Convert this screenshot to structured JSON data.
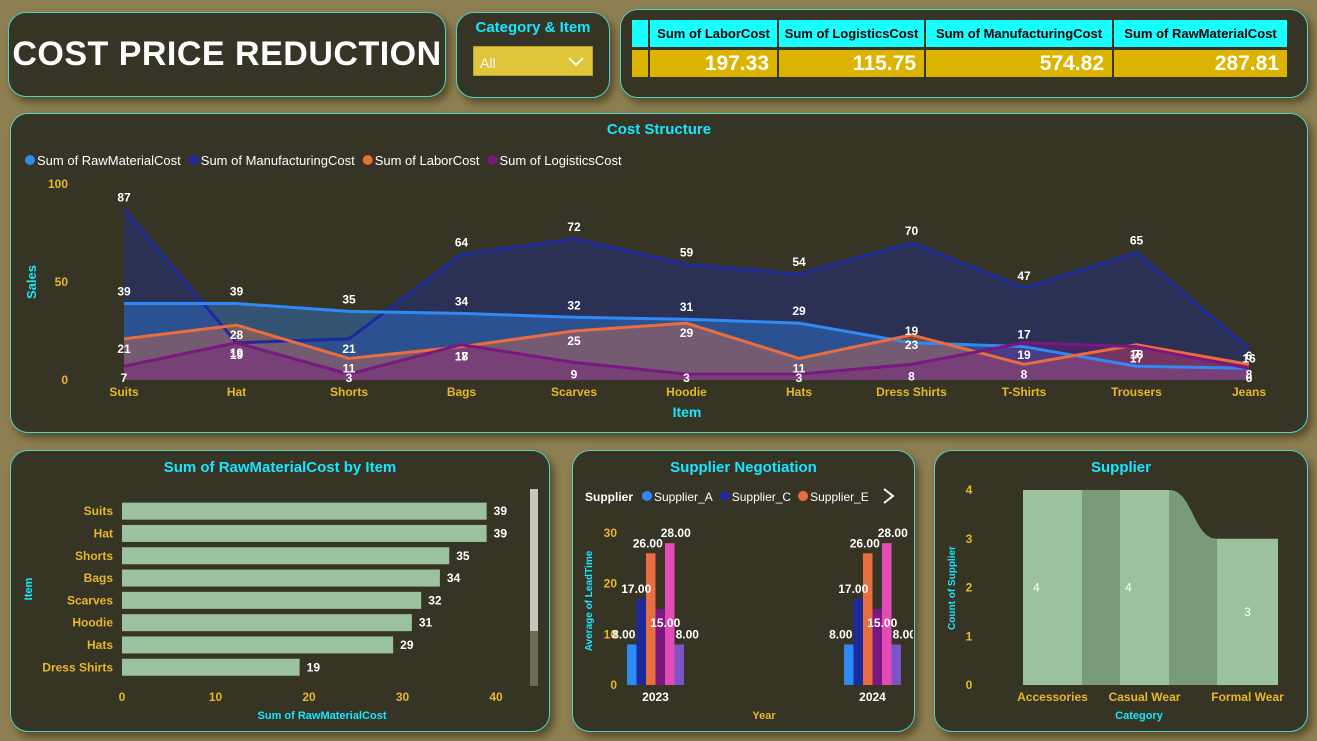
{
  "header": {
    "title": "COST PRICE REDUCTION"
  },
  "slicer": {
    "label": "Category & Item",
    "value": "All"
  },
  "kpis": [
    {
      "label": "Sum of LaborCost",
      "value": "197.33"
    },
    {
      "label": "Sum of LogisticsCost",
      "value": "115.75"
    },
    {
      "label": "Sum of ManufacturingCost",
      "value": "574.82"
    },
    {
      "label": "Sum of RawMaterialCost",
      "value": "287.81"
    }
  ],
  "colors": {
    "accent": "#19e6ff",
    "panel": "#363424",
    "kpi_value_bg": "#dcb400",
    "raw": "#2f8af5",
    "manufacturing": "#1c2a9c",
    "labor": "#e96d3e",
    "logistics": "#7b1781",
    "bar": "#9bc19e"
  },
  "chart_data": [
    {
      "type": "area",
      "title": "Cost Structure",
      "xlabel": "Item",
      "ylabel": "Sales",
      "ylim": [
        0,
        100
      ],
      "yticks": [
        0,
        50,
        100
      ],
      "legend_position": "top-left",
      "categories": [
        "Suits",
        "Hat",
        "Shorts",
        "Bags",
        "Scarves",
        "Hoodie",
        "Hats",
        "Dress Shirts",
        "T-Shirts",
        "Trousers",
        "Jeans"
      ],
      "series": [
        {
          "name": "Sum of RawMaterialCost",
          "color": "#2f8af5",
          "values": [
            39,
            39,
            35,
            34,
            32,
            31,
            29,
            19,
            17,
            7,
            6
          ]
        },
        {
          "name": "Sum of ManufacturingCost",
          "color": "#1c2a9c",
          "values": [
            87,
            19,
            21,
            64,
            72,
            59,
            54,
            70,
            47,
            65,
            16
          ]
        },
        {
          "name": "Sum of LaborCost",
          "color": "#e96d3e",
          "values": [
            21,
            28,
            11,
            17,
            25,
            29,
            11,
            23,
            8,
            18,
            8
          ]
        },
        {
          "name": "Sum of LogisticsCost",
          "color": "#7b1781",
          "values": [
            7,
            19,
            3,
            18,
            9,
            3,
            3,
            8,
            19,
            17,
            6
          ]
        }
      ]
    },
    {
      "type": "bar",
      "orientation": "horizontal",
      "title": "Sum of RawMaterialCost by Item",
      "xlabel": "Sum of RawMaterialCost",
      "ylabel": "Item",
      "xlim": [
        0,
        40
      ],
      "xticks": [
        0,
        10,
        20,
        30,
        40
      ],
      "categories": [
        "Suits",
        "Hat",
        "Shorts",
        "Bags",
        "Scarves",
        "Hoodie",
        "Hats",
        "Dress Shirts"
      ],
      "values": [
        39,
        39,
        35,
        34,
        32,
        31,
        29,
        19
      ]
    },
    {
      "type": "bar",
      "title": "Supplier Negotiation",
      "xlabel": "Year",
      "ylabel": "Average of LeadTime",
      "ylim": [
        0,
        30
      ],
      "yticks": [
        0,
        10,
        20,
        30
      ],
      "legend_title": "Supplier",
      "legend_items": [
        {
          "name": "Supplier_A",
          "color": "#2f8af5"
        },
        {
          "name": "Supplier_C",
          "color": "#1c2a9c"
        },
        {
          "name": "Supplier_E",
          "color": "#e96d3e"
        }
      ],
      "categories": [
        "2023",
        "2024"
      ],
      "series": [
        {
          "color": "#2f8af5",
          "values": [
            8.0,
            8.0
          ],
          "labels": [
            "8.00",
            "8.00"
          ]
        },
        {
          "color": "#1c2a9c",
          "values": [
            17.0,
            17.0
          ],
          "labels": [
            "17.00",
            "17.00"
          ]
        },
        {
          "color": "#e96d3e",
          "values": [
            26.0,
            26.0
          ],
          "labels": [
            "26.00",
            "26.00"
          ]
        },
        {
          "color": "#7b1781",
          "values": [
            15.0,
            15.0
          ],
          "labels": [
            "15.00",
            "15.00"
          ]
        },
        {
          "color": "#e54bb6",
          "values": [
            28.0,
            28.0
          ],
          "labels": [
            "28.00",
            "28.00"
          ]
        },
        {
          "color": "#7b54c6",
          "values": [
            8.0,
            8.0
          ],
          "labels": [
            "8.00",
            "8.00"
          ]
        }
      ]
    },
    {
      "type": "bar",
      "subtype": "ribbon",
      "title": "Supplier",
      "xlabel": "Category",
      "ylabel": "Count of Supplier",
      "ylim": [
        0,
        4
      ],
      "yticks": [
        0,
        1,
        2,
        3,
        4
      ],
      "categories": [
        "Accessories",
        "Casual Wear",
        "Formal Wear"
      ],
      "values": [
        4,
        4,
        3
      ]
    }
  ]
}
